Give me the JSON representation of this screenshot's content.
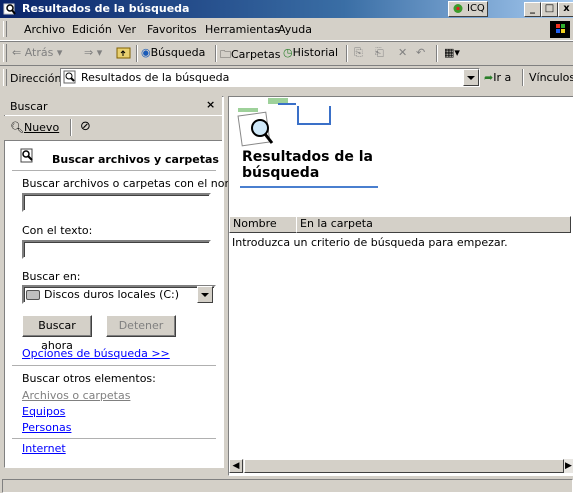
{
  "window": {
    "title": "Resultados de la búsqueda",
    "icq_label": "ICQ",
    "buttons": {
      "minimize": "_",
      "maximize": "□",
      "close": "x"
    }
  },
  "menu": [
    "Archivo",
    "Edición",
    "Ver",
    "Favoritos",
    "Herramientas",
    "Ayuda"
  ],
  "toolbar": {
    "back": "Atrás",
    "search": "Búsqueda",
    "folders": "Carpetas",
    "history": "Historial"
  },
  "address": {
    "label": "Dirección",
    "value": "Resultados de la búsqueda",
    "go": "Ir a",
    "links": "Vínculos"
  },
  "search_pane": {
    "title": "Buscar",
    "new_label": "Nuevo",
    "heading": "Buscar archivos y carpetas",
    "name_label": "Buscar archivos o carpetas con el nombre:",
    "name_value": "",
    "text_label": "Con el texto:",
    "text_value": "",
    "location_label": "Buscar en:",
    "location_value": "Discos duros locales (C:)",
    "search_now": "Buscar ahora",
    "stop": "Detener",
    "options_link": "Opciones de búsqueda  >>",
    "other_label": "Buscar otros elementos:",
    "other_items": [
      "Archivos o carpetas",
      "Equipos",
      "Personas"
    ],
    "internet": "Internet"
  },
  "results": {
    "title": "Resultados de la búsqueda",
    "columns": [
      "Nombre",
      "En la carpeta"
    ],
    "empty_message": "Introduzca un criterio de búsqueda para empezar."
  },
  "status": {
    "text": ""
  }
}
